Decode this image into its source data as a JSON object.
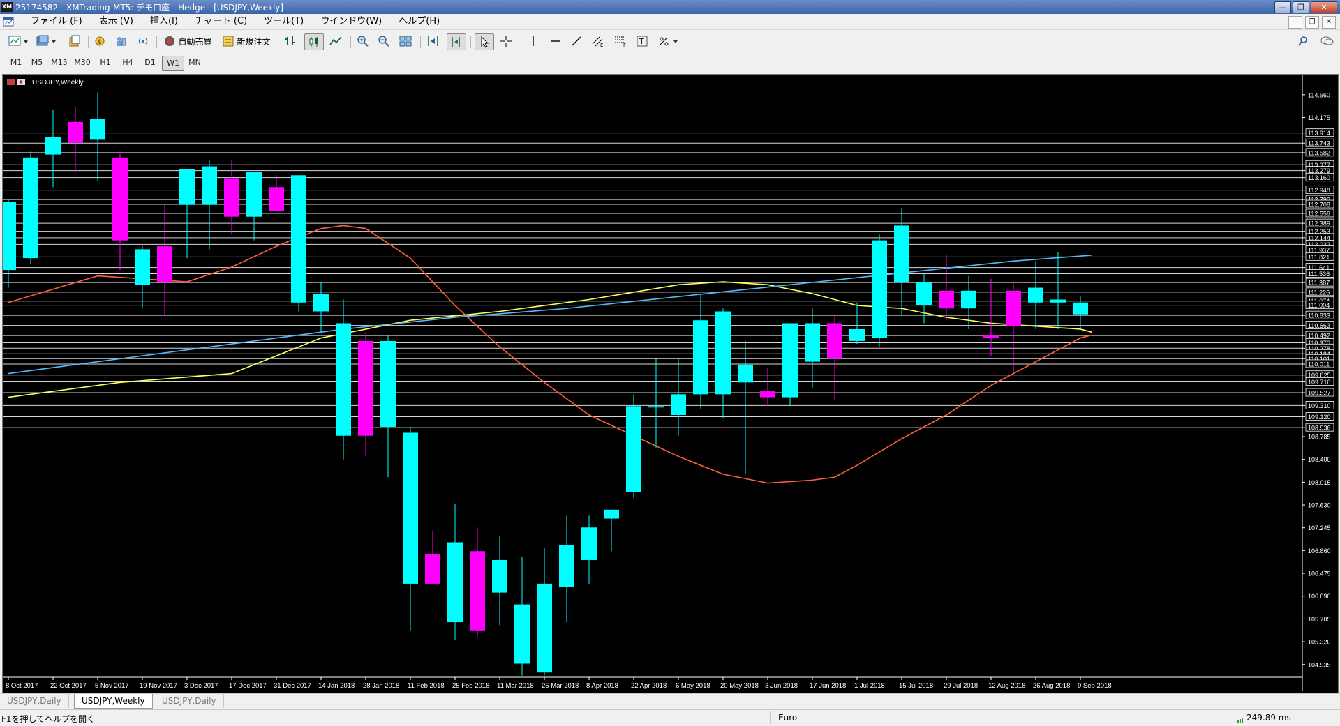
{
  "window": {
    "title": "25174582 - XMTrading-MT5: デモ口座 - Hedge - [USDJPY,Weekly]",
    "logo": "XM",
    "controls": [
      "minimize-icon",
      "restore-icon",
      "close-icon"
    ]
  },
  "menu": [
    "ファイル (F)",
    "表示 (V)",
    "挿入(I)",
    "チャート (C)",
    "ツール(T)",
    "ウインドウ(W)",
    "ヘルプ(H)"
  ],
  "toolbar": {
    "algo_trading": "自動売買",
    "new_order": "新規注文",
    "icons": [
      "new-chart-icon",
      "profiles-icon",
      "templates-icon",
      "market-watch-icon",
      "navigator-icon",
      "signals-icon",
      "algo-trading-icon",
      "new-order-icon",
      "bar-chart-icon",
      "candlestick-icon",
      "line-chart-icon",
      "zoom-in-icon",
      "zoom-out-icon",
      "tile-icon",
      "autoscroll-icon",
      "chart-shift-icon",
      "cursor-icon",
      "crosshair-icon",
      "vertical-line-icon",
      "horizontal-line-icon",
      "trendline-icon",
      "channel-icon",
      "fibonacci-icon",
      "text-icon",
      "shapes-icon",
      "search-icon",
      "chat-icon"
    ]
  },
  "timeframes": [
    "M1",
    "M5",
    "M15",
    "M30",
    "H1",
    "H4",
    "D1",
    "W1",
    "MN"
  ],
  "active_timeframe": "W1",
  "chart_data": {
    "type": "candlestick",
    "symbol_label": "USDJPY,Weekly",
    "up_color": "#00ffff",
    "down_color": "#ff00ff",
    "background": "#000000",
    "ylim": [
      104.72,
      114.9
    ],
    "y_ticks": [
      "114.560",
      "114.175",
      "113.914",
      "113.743",
      "113.582",
      "113.377",
      "113.279",
      "113.160",
      "112.948",
      "112.790",
      "112.708",
      "112.556",
      "112.389",
      "112.253",
      "112.144",
      "112.032",
      "111.937",
      "111.821",
      "111.641",
      "111.536",
      "111.387",
      "111.226",
      "111.074",
      "111.004",
      "110.833",
      "110.663",
      "110.492",
      "110.370",
      "110.278",
      "110.184",
      "110.101",
      "110.011",
      "109.825",
      "109.710",
      "109.527",
      "109.310",
      "109.120",
      "108.936",
      "108.785",
      "108.400",
      "108.015",
      "107.630",
      "107.245",
      "106.860",
      "106.475",
      "106.090",
      "105.705",
      "105.320",
      "104.935"
    ],
    "boxed_ticks": [
      "113.914",
      "113.743",
      "113.582",
      "113.377",
      "113.279",
      "113.160",
      "112.948",
      "112.790",
      "112.708",
      "112.556",
      "112.389",
      "112.253",
      "112.144",
      "112.032",
      "111.937",
      "111.821",
      "111.641",
      "111.536",
      "111.387",
      "111.226",
      "111.074",
      "111.004",
      "110.833",
      "110.663",
      "110.492",
      "110.370",
      "110.278",
      "110.184",
      "110.101",
      "110.011",
      "109.825",
      "109.710",
      "109.527",
      "109.310",
      "109.120",
      "108.936"
    ],
    "horizontal_levels": [
      113.914,
      113.743,
      113.582,
      113.377,
      113.279,
      113.16,
      112.948,
      112.79,
      112.708,
      112.556,
      112.389,
      112.253,
      112.144,
      112.032,
      111.937,
      111.821,
      111.641,
      111.536,
      111.387,
      111.226,
      111.074,
      111.004,
      110.833,
      110.663,
      110.492,
      110.37,
      110.278,
      110.184,
      110.101,
      110.011,
      109.825,
      109.71,
      109.527,
      109.31,
      109.12,
      108.936
    ],
    "x_labels": [
      "8 Oct 2017",
      "22 Oct 2017",
      "5 Nov 2017",
      "19 Nov 2017",
      "3 Dec 2017",
      "17 Dec 2017",
      "31 Dec 2017",
      "14 Jan 2018",
      "28 Jan 2018",
      "11 Feb 2018",
      "25 Feb 2018",
      "11 Mar 2018",
      "25 Mar 2018",
      "8 Apr 2018",
      "22 Apr 2018",
      "6 May 2018",
      "20 May 2018",
      "3 Jun 2018",
      "17 Jun 2018",
      "1 Jul 2018",
      "15 Jul 2018",
      "29 Jul 2018",
      "12 Aug 2018",
      "26 Aug 2018",
      "9 Sep 2018"
    ],
    "candles": [
      {
        "o": 111.6,
        "h": 112.8,
        "l": 111.3,
        "c": 112.75
      },
      {
        "o": 111.8,
        "h": 113.6,
        "l": 111.7,
        "c": 113.5
      },
      {
        "o": 113.55,
        "h": 114.3,
        "l": 113.0,
        "c": 113.85
      },
      {
        "o": 114.1,
        "h": 114.35,
        "l": 113.25,
        "c": 113.75
      },
      {
        "o": 113.8,
        "h": 114.6,
        "l": 113.1,
        "c": 114.15
      },
      {
        "o": 113.5,
        "h": 113.6,
        "l": 111.6,
        "c": 112.1
      },
      {
        "o": 111.35,
        "h": 112.0,
        "l": 110.95,
        "c": 111.95
      },
      {
        "o": 112.0,
        "h": 112.7,
        "l": 110.85,
        "c": 111.4
      },
      {
        "o": 112.7,
        "h": 113.05,
        "l": 111.8,
        "c": 113.3
      },
      {
        "o": 112.7,
        "h": 113.45,
        "l": 111.95,
        "c": 113.35
      },
      {
        "o": 113.15,
        "h": 113.45,
        "l": 112.2,
        "c": 112.5
      },
      {
        "o": 112.5,
        "h": 113.2,
        "l": 112.1,
        "c": 113.25
      },
      {
        "o": 113.0,
        "h": 113.2,
        "l": 112.6,
        "c": 112.6
      },
      {
        "o": 111.05,
        "h": 113.2,
        "l": 110.9,
        "c": 113.2
      },
      {
        "o": 110.9,
        "h": 111.4,
        "l": 110.55,
        "c": 111.2
      },
      {
        "o": 108.8,
        "h": 111.1,
        "l": 108.4,
        "c": 110.7
      },
      {
        "o": 110.4,
        "h": 110.55,
        "l": 108.45,
        "c": 108.8
      },
      {
        "o": 108.95,
        "h": 110.5,
        "l": 108.1,
        "c": 110.4
      },
      {
        "o": 106.3,
        "h": 108.95,
        "l": 105.5,
        "c": 108.85
      },
      {
        "o": 106.8,
        "h": 107.2,
        "l": 106.3,
        "c": 106.3
      },
      {
        "o": 105.65,
        "h": 107.65,
        "l": 105.35,
        "c": 107.0
      },
      {
        "o": 106.85,
        "h": 107.25,
        "l": 105.4,
        "c": 105.5
      },
      {
        "o": 106.15,
        "h": 107.1,
        "l": 105.6,
        "c": 106.7
      },
      {
        "o": 104.95,
        "h": 106.75,
        "l": 104.75,
        "c": 105.95
      },
      {
        "o": 104.8,
        "h": 106.9,
        "l": 104.75,
        "c": 106.3
      },
      {
        "o": 106.25,
        "h": 107.45,
        "l": 105.65,
        "c": 106.95
      },
      {
        "o": 106.7,
        "h": 107.45,
        "l": 106.3,
        "c": 107.25
      },
      {
        "o": 107.4,
        "h": 107.55,
        "l": 106.85,
        "c": 107.55
      },
      {
        "o": 107.85,
        "h": 109.5,
        "l": 107.75,
        "c": 109.3
      },
      {
        "o": 109.3,
        "h": 110.1,
        "l": 108.6,
        "c": 109.3
      },
      {
        "o": 109.15,
        "h": 110.1,
        "l": 108.8,
        "c": 109.5
      },
      {
        "o": 109.5,
        "h": 111.2,
        "l": 109.25,
        "c": 110.75
      },
      {
        "o": 109.5,
        "h": 110.95,
        "l": 109.1,
        "c": 110.9
      },
      {
        "o": 109.7,
        "h": 110.4,
        "l": 108.15,
        "c": 110.0
      },
      {
        "o": 109.55,
        "h": 109.95,
        "l": 109.3,
        "c": 109.45
      },
      {
        "o": 109.45,
        "h": 110.7,
        "l": 109.3,
        "c": 110.7
      },
      {
        "o": 110.05,
        "h": 110.95,
        "l": 109.6,
        "c": 110.7
      },
      {
        "o": 110.7,
        "h": 110.85,
        "l": 109.4,
        "c": 110.1
      },
      {
        "o": 110.4,
        "h": 111.05,
        "l": 110.35,
        "c": 110.6
      },
      {
        "o": 110.45,
        "h": 112.2,
        "l": 110.3,
        "c": 112.1
      },
      {
        "o": 111.4,
        "h": 112.65,
        "l": 110.85,
        "c": 112.35
      },
      {
        "o": 111.0,
        "h": 111.55,
        "l": 110.7,
        "c": 111.4
      },
      {
        "o": 111.25,
        "h": 111.85,
        "l": 110.75,
        "c": 110.95
      },
      {
        "o": 110.95,
        "h": 111.5,
        "l": 110.6,
        "c": 111.25
      },
      {
        "o": 110.5,
        "h": 111.45,
        "l": 110.15,
        "c": 110.45
      },
      {
        "o": 111.25,
        "h": 111.4,
        "l": 109.85,
        "c": 110.65
      },
      {
        "o": 111.05,
        "h": 111.75,
        "l": 110.6,
        "c": 111.3
      },
      {
        "o": 111.05,
        "h": 111.9,
        "l": 110.6,
        "c": 111.1
      },
      {
        "o": 110.85,
        "h": 111.15,
        "l": 110.6,
        "c": 111.05
      }
    ],
    "ma_series": [
      {
        "color": "#ff5f3f",
        "points": [
          [
            0,
            111.05
          ],
          [
            4,
            111.5
          ],
          [
            6,
            111.45
          ],
          [
            8,
            111.4
          ],
          [
            10,
            111.65
          ],
          [
            12,
            112.0
          ],
          [
            14,
            112.3
          ],
          [
            15,
            112.35
          ],
          [
            16,
            112.3
          ],
          [
            18,
            111.8
          ],
          [
            20,
            111.0
          ],
          [
            22,
            110.3
          ],
          [
            24,
            109.7
          ],
          [
            26,
            109.15
          ],
          [
            28,
            108.8
          ],
          [
            30,
            108.45
          ],
          [
            32,
            108.15
          ],
          [
            34,
            108.0
          ],
          [
            36,
            108.05
          ],
          [
            37,
            108.1
          ],
          [
            38,
            108.3
          ],
          [
            40,
            108.75
          ],
          [
            42,
            109.15
          ],
          [
            44,
            109.65
          ],
          [
            46,
            110.05
          ],
          [
            48,
            110.45
          ],
          [
            48.5,
            110.5
          ]
        ]
      },
      {
        "color": "#ffff55",
        "points": [
          [
            0,
            109.45
          ],
          [
            5,
            109.7
          ],
          [
            10,
            109.85
          ],
          [
            14,
            110.45
          ],
          [
            18,
            110.75
          ],
          [
            22,
            110.9
          ],
          [
            26,
            111.1
          ],
          [
            30,
            111.35
          ],
          [
            32,
            111.4
          ],
          [
            34,
            111.35
          ],
          [
            36,
            111.2
          ],
          [
            38,
            111.0
          ],
          [
            40,
            110.95
          ],
          [
            42,
            110.8
          ],
          [
            44,
            110.7
          ],
          [
            46,
            110.65
          ],
          [
            48,
            110.6
          ],
          [
            48.5,
            110.55
          ]
        ]
      },
      {
        "color": "#55bbff",
        "points": [
          [
            0,
            109.85
          ],
          [
            5,
            110.1
          ],
          [
            10,
            110.35
          ],
          [
            15,
            110.6
          ],
          [
            20,
            110.8
          ],
          [
            25,
            110.95
          ],
          [
            30,
            111.15
          ],
          [
            35,
            111.35
          ],
          [
            40,
            111.55
          ],
          [
            45,
            111.75
          ],
          [
            48.5,
            111.85
          ]
        ]
      }
    ]
  },
  "tabs": [
    "USDJPY,Daily",
    "USDJPY,Weekly",
    "USDJPY,Daily"
  ],
  "active_tab": 1,
  "status": {
    "help": "F1を押してヘルプを開く",
    "profile": "Euro",
    "ping": "249.89 ms"
  }
}
